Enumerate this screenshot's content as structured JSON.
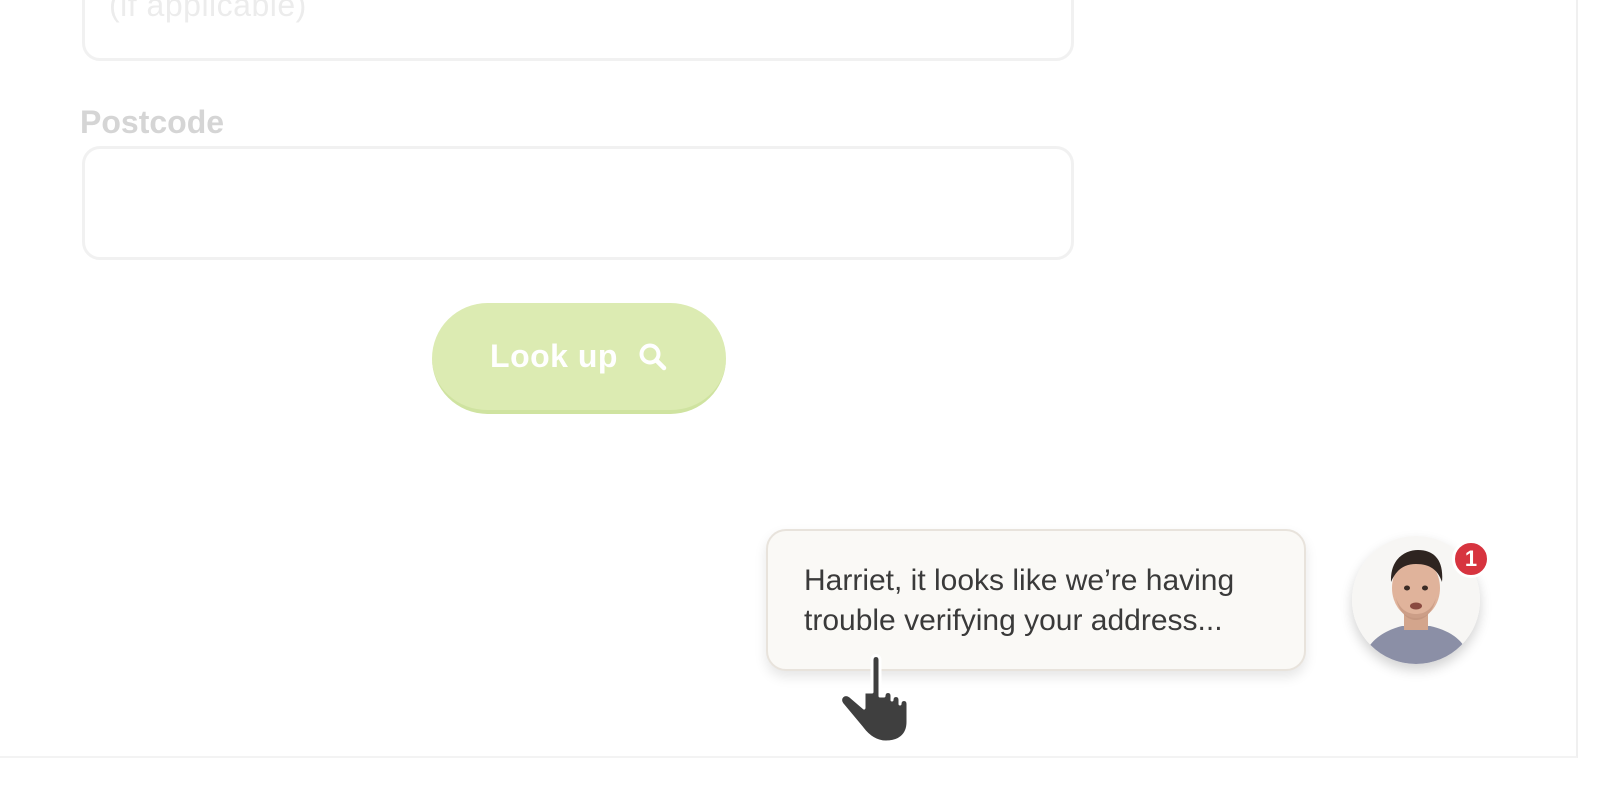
{
  "form": {
    "address_line_placeholder": "(if applicable)",
    "postcode_label": "Postcode",
    "postcode_value": "",
    "lookup_button_label": "Look up"
  },
  "chat": {
    "message": "Harriet, it looks like we’re having trouble verifying your address...",
    "unread_count": "1"
  },
  "colors": {
    "lookup_button": "#dcebb2",
    "badge": "#d7343f",
    "bubble_bg": "#faf9f6"
  },
  "icons": {
    "lookup": "search-icon",
    "cursor": "hand-pointer-icon"
  }
}
